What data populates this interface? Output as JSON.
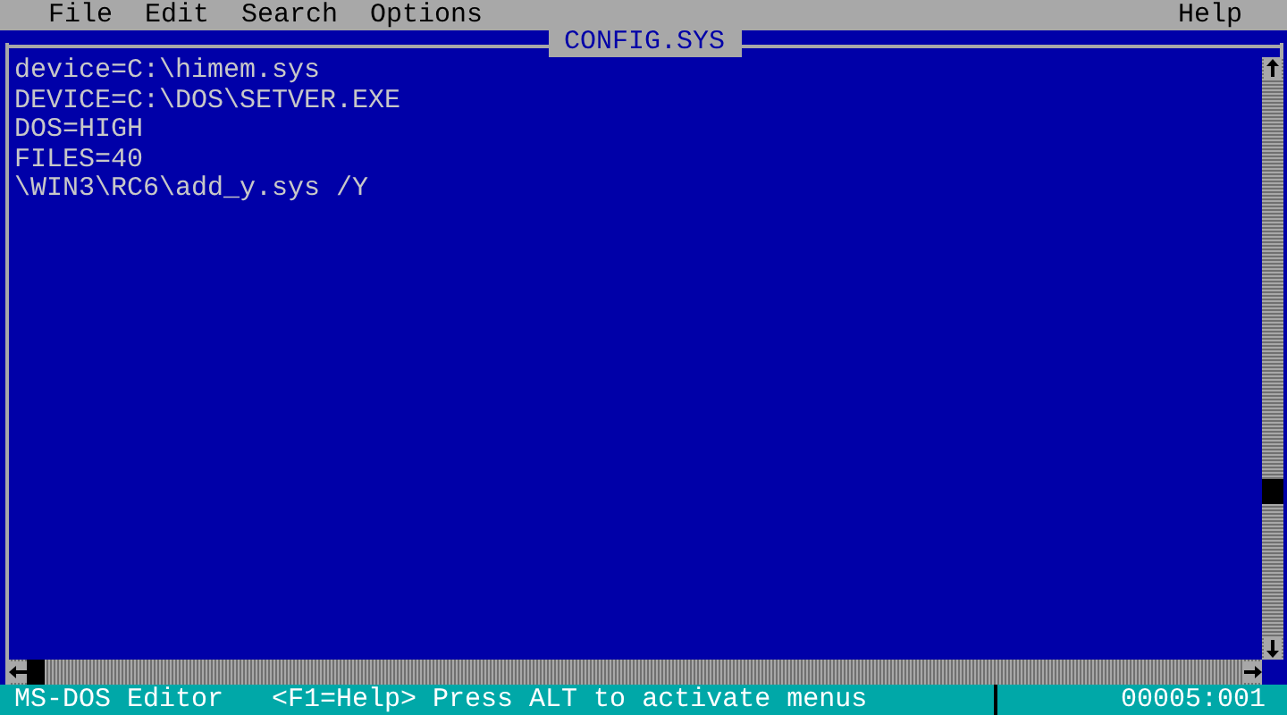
{
  "menu_bar": {
    "items": [
      "File",
      "Edit",
      "Search",
      "Options"
    ],
    "help": "Help"
  },
  "document": {
    "title": "CONFIG.SYS",
    "lines": [
      "device=C:\\himem.sys",
      "DEVICE=C:\\DOS\\SETVER.EXE",
      "DOS=HIGH",
      "FILES=40",
      "\\WIN3\\RC6\\add_y.sys /Y"
    ]
  },
  "status_bar": {
    "app_name": "MS-DOS Editor",
    "hint": "<F1=Help> Press ALT to activate menus",
    "position": "00005:001"
  }
}
